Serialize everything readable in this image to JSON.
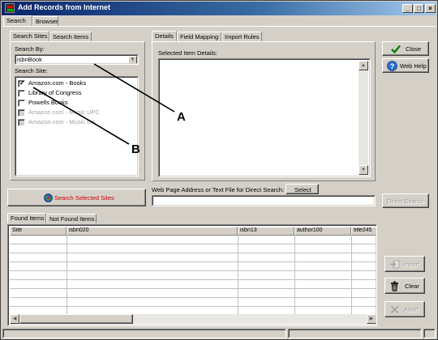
{
  "window": {
    "title": "Add Records from Internet",
    "controls": {
      "minimize": "_",
      "maximize": "□",
      "close": "×"
    }
  },
  "outer_tabs": [
    "Search",
    "Browser"
  ],
  "left_tabs": [
    "Search Sites",
    "Search Items"
  ],
  "search_by": {
    "label": "Search By:",
    "value": "isbnBook"
  },
  "search_site": {
    "label": "Search Site:",
    "items": [
      {
        "label": "Amazon.com - Books",
        "checked": true,
        "enabled": true
      },
      {
        "label": "Library of Congress",
        "checked": false,
        "enabled": true
      },
      {
        "label": "Powells Books",
        "checked": false,
        "enabled": true
      },
      {
        "label": "Amazon.com - Music UPC",
        "checked": false,
        "enabled": false
      },
      {
        "label": "Amazon.com - Music Dis",
        "checked": false,
        "enabled": false
      }
    ]
  },
  "search_selected_sites_label": "Search Selected Sites",
  "right_tabs": [
    "Details",
    "Field Mapping",
    "Import Rules"
  ],
  "selected_item_details_label": "Selected Item Details:",
  "side_buttons": {
    "close": "Close",
    "web_help": "Web Help"
  },
  "direct_search": {
    "label": "Web Page Address or Text File for Direct Search:",
    "select_label": "Select",
    "direct_search_button": "Direct Search"
  },
  "bottom_tabs": [
    "Found Items",
    "Not Found Items"
  ],
  "grid": {
    "columns": [
      "Site",
      "isbn020",
      "isbn13",
      "author100",
      "title245"
    ]
  },
  "bottom_buttons": {
    "import": "Import",
    "clear": "Clear",
    "abort": "Abort"
  },
  "annotations": {
    "a": "A",
    "b": "B"
  }
}
